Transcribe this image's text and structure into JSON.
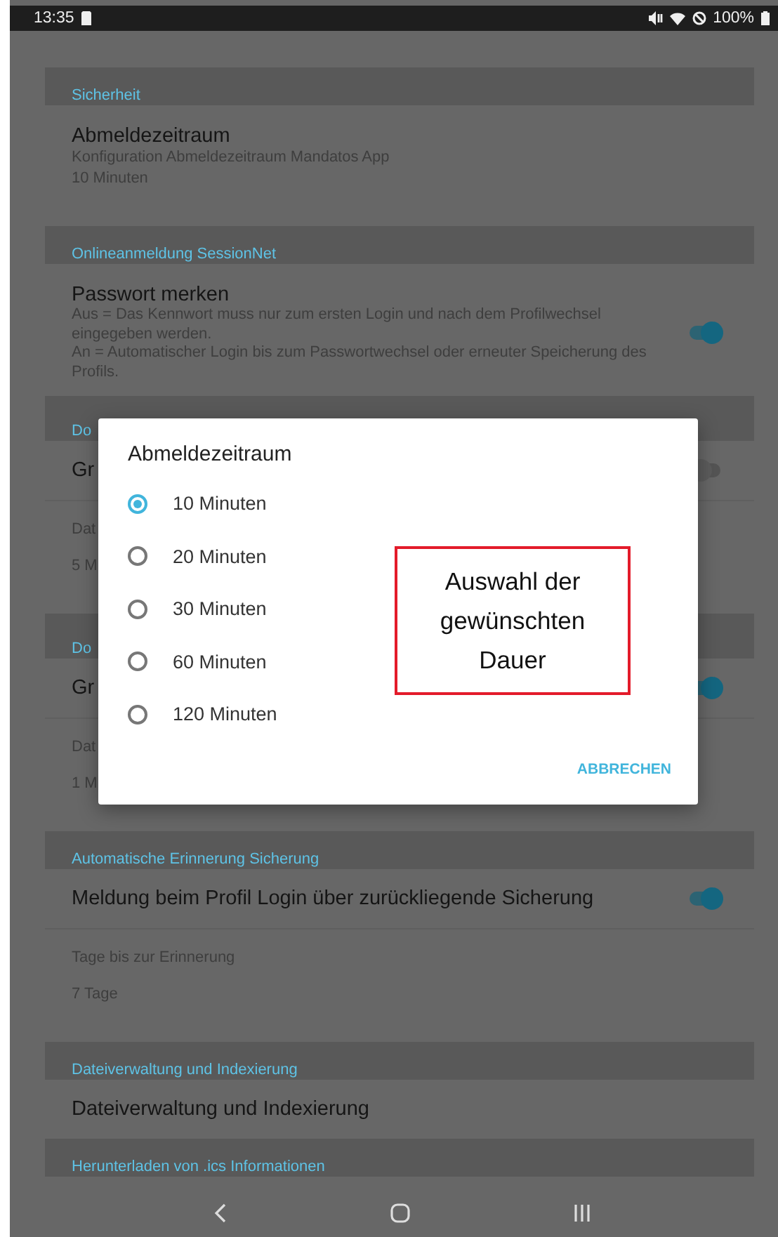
{
  "status_bar": {
    "time": "13:35",
    "battery": "100%"
  },
  "sections": [
    {
      "title": "Sicherheit",
      "items": [
        {
          "kind": "pref",
          "title": "Abmeldezeitraum",
          "summary": "Konfiguration Abmeldezeitraum Mandatos App",
          "value": "10 Minuten"
        }
      ]
    },
    {
      "title": "Onlineanmeldung SessionNet",
      "items": [
        {
          "kind": "toggle",
          "title": "Passwort merken",
          "description": [
            "Aus = Das Kennwort muss nur zum ersten Login und nach dem Profilwechsel eingegeben werden.",
            "An = Automatischer Login bis zum Passwortwechsel oder erneuter Speicherung des Profils."
          ],
          "on": true
        }
      ]
    },
    {
      "title": "Do",
      "items": [
        {
          "kind": "toggle",
          "title": "Gr",
          "on": false
        },
        {
          "kind": "pref",
          "summary": "Dat",
          "value": "5 M"
        }
      ]
    },
    {
      "title": "Do",
      "items": [
        {
          "kind": "toggle",
          "title": "Gr",
          "on": true
        },
        {
          "kind": "pref",
          "summary": "Dat",
          "value": "1 M"
        }
      ]
    },
    {
      "title": "Automatische Erinnerung Sicherung",
      "items": [
        {
          "kind": "toggle",
          "title": "Meldung beim Profil Login über zurückliegende Sicherung",
          "on": true
        },
        {
          "kind": "pref",
          "summary": "Tage bis zur Erinnerung",
          "value": "7 Tage"
        }
      ]
    },
    {
      "title": "Dateiverwaltung und Indexierung",
      "items": [
        {
          "kind": "link",
          "title": "Dateiverwaltung und Indexierung"
        }
      ]
    },
    {
      "title": "Herunterladen von .ics Informationen"
    }
  ],
  "dialog": {
    "title": "Abmeldezeitraum",
    "options": [
      {
        "label": "10 Minuten",
        "selected": true
      },
      {
        "label": "20 Minuten",
        "selected": false
      },
      {
        "label": "30 Minuten",
        "selected": false
      },
      {
        "label": "60 Minuten",
        "selected": false
      },
      {
        "label": "120 Minuten",
        "selected": false
      }
    ],
    "annotation": "Auswahl der gewünschten Dauer",
    "cancel": "ABBRECHEN"
  }
}
